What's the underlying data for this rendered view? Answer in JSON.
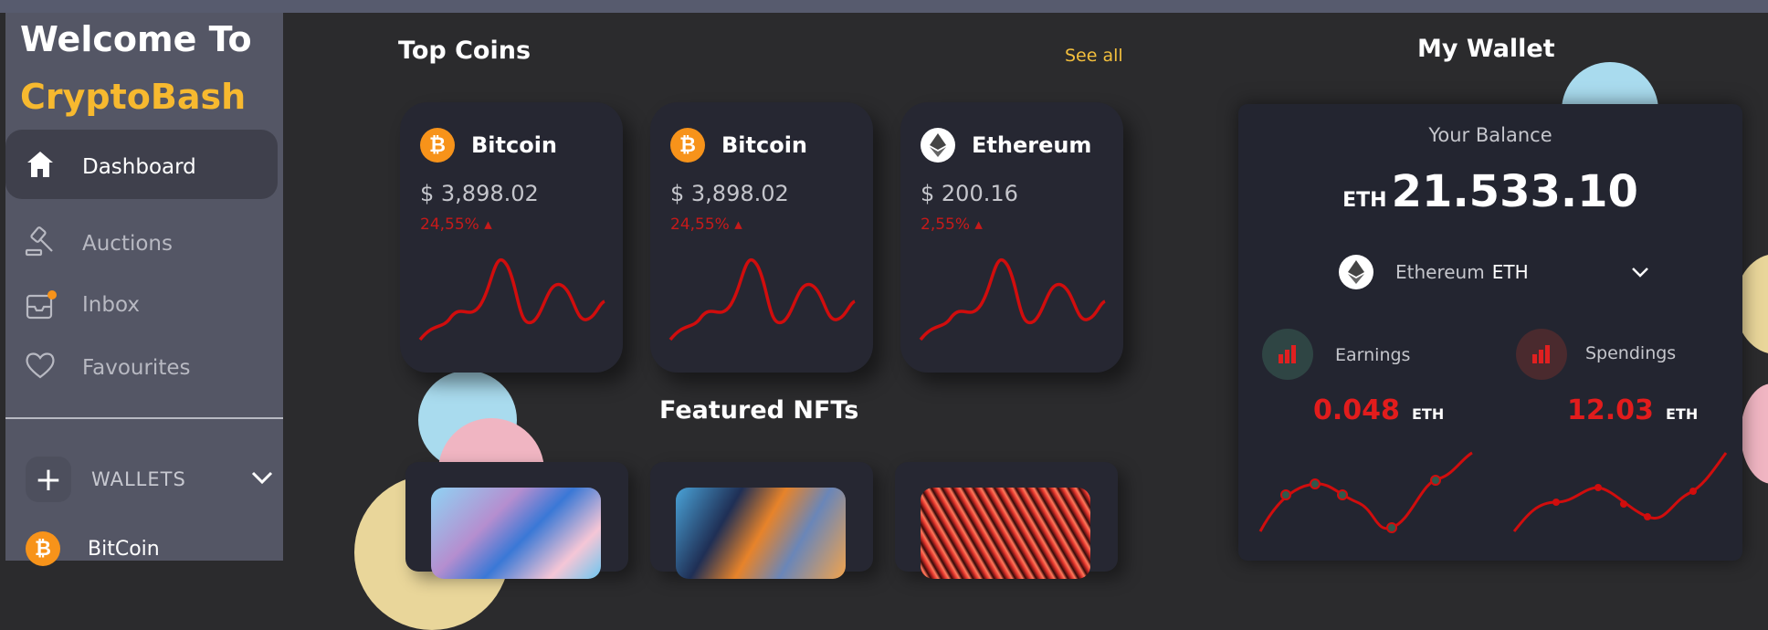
{
  "sidebar": {
    "welcome": "Welcome To",
    "brand": "CryptoBash",
    "items": [
      {
        "label": "Dashboard",
        "icon": "home-icon",
        "active": true
      },
      {
        "label": "Auctions",
        "icon": "gavel-icon"
      },
      {
        "label": "Inbox",
        "icon": "inbox-icon"
      },
      {
        "label": "Favourites",
        "icon": "heart-icon"
      }
    ],
    "wallets_label": "WALLETS",
    "wallet_items": [
      {
        "label": "BitCoin",
        "icon": "bitcoin-icon"
      }
    ]
  },
  "top_coins": {
    "title": "Top Coins",
    "see_all": "See all",
    "cards": [
      {
        "name": "Bitcoin",
        "price": "$ 3,898.02",
        "change": "24,55%",
        "icon": "bitcoin-icon"
      },
      {
        "name": "Bitcoin",
        "price": "$ 3,898.02",
        "change": "24,55%",
        "icon": "bitcoin-icon"
      },
      {
        "name": "Ethereum",
        "price": "$ 200.16",
        "change": "2,55%",
        "icon": "ethereum-icon"
      }
    ]
  },
  "nfts": {
    "title": "Featured NFTs"
  },
  "wallet": {
    "title": "My Wallet",
    "balance_label": "Your Balance",
    "balance_unit": "ETH",
    "balance_value": "21.533.10",
    "currency_name": "Ethereum",
    "currency_code": "ETH",
    "earnings_label": "Earnings",
    "earnings_value": "0.048",
    "earnings_unit": "ETH",
    "spendings_label": "Spendings",
    "spendings_value": "12.03",
    "spendings_unit": "ETH"
  },
  "colors": {
    "accent": "#f7b92f",
    "negative": "#d8141c",
    "panel": "#262732"
  }
}
